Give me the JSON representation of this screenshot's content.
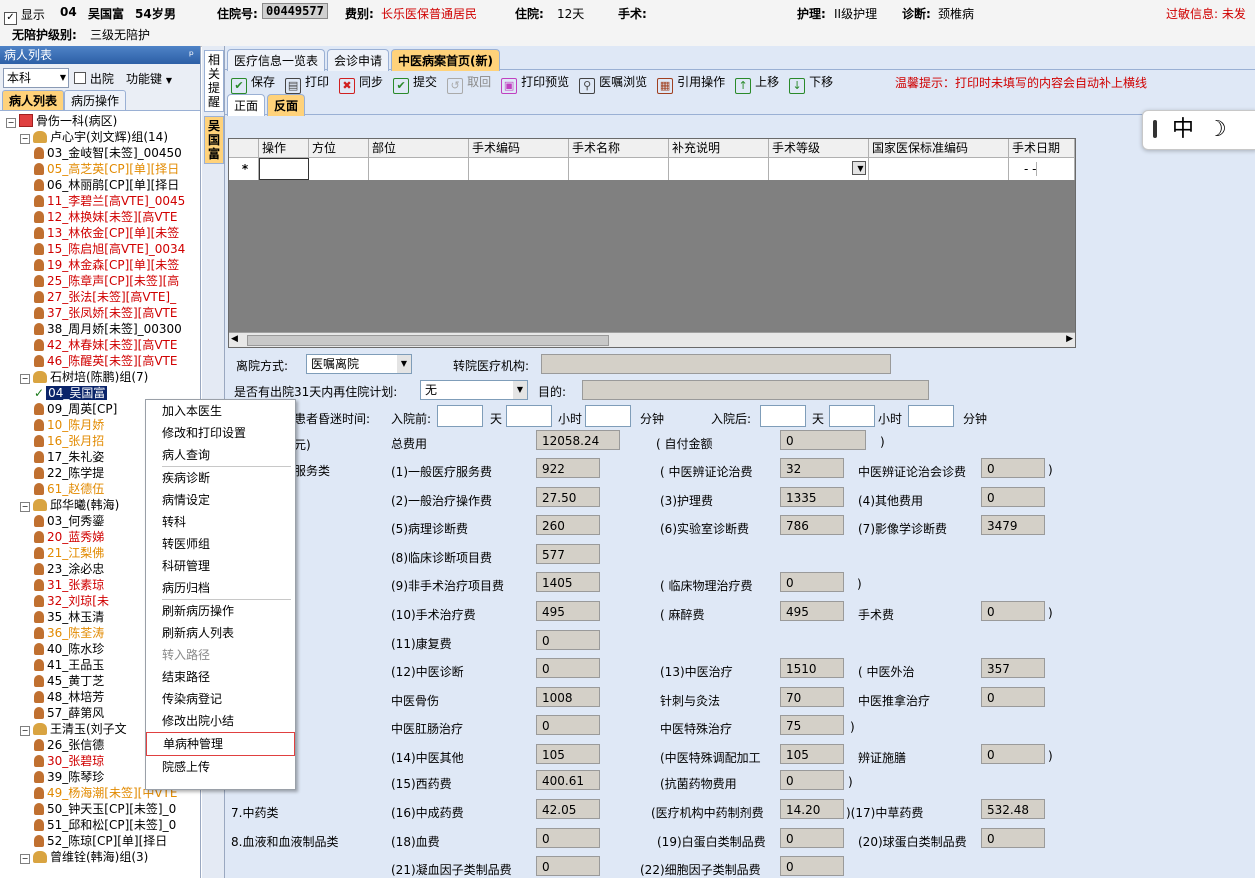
{
  "topbar": {
    "show_label": "显示",
    "bed_no": "04",
    "patient_name": "吴国富",
    "age": "54岁",
    "sex": "男",
    "admission_no_label": "住院号:",
    "admission_no": "00449577",
    "fee_type_label": "费别:",
    "fee_type": "长乐医保普通居民",
    "stay_label": "住院:",
    "stay_days": "12天",
    "surgery_label": "手术:",
    "care_label": "护理:",
    "care_value": "II级护理",
    "diagnosis_label": "诊断:",
    "diagnosis_value": "颈椎病",
    "allergy_text": "过敏信息: 未发",
    "escort_label": "无陪护级别:",
    "escort_value": "三级无陪护"
  },
  "left": {
    "header": "病人列表",
    "pin": "ᵖ",
    "dept_value": "本科",
    "discharge_label": "出院",
    "func_label": "功能键",
    "tabs": [
      "病人列表",
      "病历操作"
    ],
    "tree": [
      {
        "indent": 0,
        "type": "dept",
        "text": "骨伤一科(病区)",
        "color": "#000"
      },
      {
        "indent": 1,
        "type": "group",
        "text": "卢心宇(刘文辉)组(14)",
        "color": "#000"
      },
      {
        "indent": 2,
        "type": "p",
        "text": "03_金岐智[未签]_00450",
        "color": "#000"
      },
      {
        "indent": 2,
        "type": "p",
        "text": "05_高芝英[CP][单][择日",
        "color": "#e28a00"
      },
      {
        "indent": 2,
        "type": "p",
        "text": "06_林丽鹃[CP][单][择日",
        "color": "#000"
      },
      {
        "indent": 2,
        "type": "p",
        "text": "11_李碧兰[高VTE]_0045",
        "color": "#d00000"
      },
      {
        "indent": 2,
        "type": "p",
        "text": "12_林换妹[未签][高VTE",
        "color": "#d00000"
      },
      {
        "indent": 2,
        "type": "p",
        "text": "13_林依金[CP][单][未签",
        "color": "#d00000"
      },
      {
        "indent": 2,
        "type": "p",
        "text": "15_陈启旭[高VTE]_0034",
        "color": "#d00000"
      },
      {
        "indent": 2,
        "type": "p",
        "text": "19_林金森[CP][单][未签",
        "color": "#d00000"
      },
      {
        "indent": 2,
        "type": "p",
        "text": "25_陈章声[CP][未签][高",
        "color": "#d00000"
      },
      {
        "indent": 2,
        "type": "p",
        "text": "27_张法[未签][高VTE]_",
        "color": "#d00000"
      },
      {
        "indent": 2,
        "type": "p",
        "text": "37_张凤娇[未签][高VTE",
        "color": "#d00000"
      },
      {
        "indent": 2,
        "type": "p",
        "text": "38_周月娇[未签]_00300",
        "color": "#000"
      },
      {
        "indent": 2,
        "type": "p",
        "text": "42_林春妹[未签][高VTE",
        "color": "#d00000"
      },
      {
        "indent": 2,
        "type": "p",
        "text": "46_陈醒英[未签][高VTE",
        "color": "#d00000"
      },
      {
        "indent": 1,
        "type": "group",
        "text": "石树培(陈鹏)组(7)",
        "color": "#000"
      },
      {
        "indent": 2,
        "type": "sel",
        "text": "04_吴国富",
        "color": "#fff"
      },
      {
        "indent": 2,
        "type": "p",
        "text": "09_周英[CP]",
        "color": "#000"
      },
      {
        "indent": 2,
        "type": "p",
        "text": "10_陈月娇",
        "color": "#e28a00"
      },
      {
        "indent": 2,
        "type": "p",
        "text": "16_张月招",
        "color": "#e28a00"
      },
      {
        "indent": 2,
        "type": "p",
        "text": "17_朱礼姿",
        "color": "#000"
      },
      {
        "indent": 2,
        "type": "p",
        "text": "22_陈学提",
        "color": "#000"
      },
      {
        "indent": 2,
        "type": "p",
        "text": "61_赵德伍",
        "color": "#e28a00"
      },
      {
        "indent": 1,
        "type": "group",
        "text": "邱华曦(韩海)",
        "color": "#000"
      },
      {
        "indent": 2,
        "type": "p",
        "text": "03_何秀鎏",
        "color": "#000"
      },
      {
        "indent": 2,
        "type": "p",
        "text": "20_蓝秀娣",
        "color": "#d00000"
      },
      {
        "indent": 2,
        "type": "p",
        "text": "21_江梨佛",
        "color": "#e28a00"
      },
      {
        "indent": 2,
        "type": "p",
        "text": "23_涂必忠",
        "color": "#000"
      },
      {
        "indent": 2,
        "type": "p",
        "text": "31_张素琼",
        "color": "#d00000"
      },
      {
        "indent": 2,
        "type": "p",
        "text": "32_刘琼[未",
        "color": "#d00000"
      },
      {
        "indent": 2,
        "type": "p",
        "text": "35_林玉清",
        "color": "#000"
      },
      {
        "indent": 2,
        "type": "p",
        "text": "36_陈荃涛",
        "color": "#e28a00"
      },
      {
        "indent": 2,
        "type": "p",
        "text": "40_陈水珍",
        "color": "#000"
      },
      {
        "indent": 2,
        "type": "p",
        "text": "41_王品玉",
        "color": "#000"
      },
      {
        "indent": 2,
        "type": "p",
        "text": "45_黄丁芝",
        "color": "#000"
      },
      {
        "indent": 2,
        "type": "p",
        "text": "48_林培芳",
        "color": "#000"
      },
      {
        "indent": 2,
        "type": "p",
        "text": "57_薛第风",
        "color": "#000"
      },
      {
        "indent": 1,
        "type": "group",
        "text": "王清玉(刘子文",
        "color": "#000"
      },
      {
        "indent": 2,
        "type": "p",
        "text": "26_张信德",
        "color": "#000"
      },
      {
        "indent": 2,
        "type": "p",
        "text": "30_张碧琼",
        "color": "#d00000"
      },
      {
        "indent": 2,
        "type": "p",
        "text": "39_陈琴珍",
        "color": "#000"
      },
      {
        "indent": 2,
        "type": "p",
        "text": "49_杨海潮[未签][中VTE",
        "color": "#e28a00"
      },
      {
        "indent": 2,
        "type": "p",
        "text": "50_钟天玉[CP][未签]_0",
        "color": "#000"
      },
      {
        "indent": 2,
        "type": "p",
        "text": "51_邱和松[CP][未签]_0",
        "color": "#000"
      },
      {
        "indent": 2,
        "type": "p",
        "text": "52_陈琼[CP][单][择日",
        "color": "#000"
      },
      {
        "indent": 1,
        "type": "group",
        "text": "曾维铨(韩海)组(3)",
        "color": "#000"
      }
    ]
  },
  "vtabs": [
    "相关提醒",
    "吴国富"
  ],
  "main": {
    "tabs": [
      "医疗信息一览表",
      "会诊申请",
      "中医病案首页(新)"
    ],
    "toolbar": [
      {
        "label": "保存",
        "icon": "save-icon",
        "color": "#2a8a2a",
        "glyph": "✔",
        "disabled": false
      },
      {
        "label": "打印",
        "icon": "print-icon",
        "color": "#444",
        "glyph": "▤",
        "disabled": false
      },
      {
        "label": "同步",
        "icon": "sync-icon",
        "color": "#d02020",
        "glyph": "✖",
        "disabled": false
      },
      {
        "label": "提交",
        "icon": "submit-icon",
        "color": "#2a8a2a",
        "glyph": "✔",
        "disabled": false
      },
      {
        "label": "取回",
        "icon": "retrieve-icon",
        "color": "#aaa",
        "glyph": "↺",
        "disabled": true
      },
      {
        "label": "打印预览",
        "icon": "print-preview-icon",
        "color": "#c040c0",
        "glyph": "▣",
        "disabled": false
      },
      {
        "label": "医嘱浏览",
        "icon": "search-icon",
        "color": "#444",
        "glyph": "⚲",
        "disabled": false
      },
      {
        "label": "引用操作",
        "icon": "quote-icon",
        "color": "#a04020",
        "glyph": "▦",
        "disabled": false
      },
      {
        "label": "上移",
        "icon": "arrow-up-icon",
        "color": "#2a8a2a",
        "glyph": "↑",
        "disabled": false
      },
      {
        "label": "下移",
        "icon": "arrow-down-icon",
        "color": "#2a8a2a",
        "glyph": "↓",
        "disabled": false
      }
    ],
    "hint": "温馨提示：打印时未填写的内容会自动补上横线",
    "subtabs": [
      "正面",
      "反面"
    ],
    "grid_columns": [
      "操作",
      "方位",
      "部位",
      "手术编码",
      "手术名称",
      "补充说明",
      "手术等级",
      "国家医保标准编码",
      "手术日期"
    ],
    "grid_new_row_marker": "*",
    "grid_date_placeholder": "- -"
  },
  "form": {
    "discharge_method_label": "离院方式:",
    "discharge_method_value": "医嘱离院",
    "transfer_org_label": "转院医疗机构:",
    "readmit_label": "是否有出院31天内再住院计划:",
    "readmit_value": "无",
    "purpose_label": "目的:",
    "coma_label": "患者昏迷时间:",
    "before_label": "入院前:",
    "after_label": "入院后:",
    "day": "天",
    "hour": "小时",
    "minute": "分钟",
    "fee_unit_label": "元)",
    "service_label": "服务类",
    "total_label": "总费用",
    "total_value": "12058.24",
    "self_pay_label": "( 自付金额",
    "self_pay_value": "0",
    "close_paren": ")",
    "f1_label": "(1)一般医疗服务费",
    "f1": "922",
    "f_tcm_diff_label": "( 中医辨证论治费",
    "f_tcm_diff": "32",
    "f_tcm_consult_label": "中医辨证论治会诊费",
    "f_tcm_consult": "0",
    "f2_label": "(2)一般治疗操作费",
    "f2": "27.50",
    "f3_label": "(3)护理费",
    "f3": "1335",
    "f4_label": "(4)其他费用",
    "f4": "0",
    "f5_label": "(5)病理诊断费",
    "f5": "260",
    "f6_label": "(6)实验室诊断费",
    "f6": "786",
    "f7_label": "(7)影像学诊断费",
    "f7": "3479",
    "f8_label": "(8)临床诊断项目费",
    "f8": "577",
    "f9_label": "(9)非手术治疗项目费",
    "f9": "1405",
    "f_physio_label": "( 临床物理治疗费",
    "f_physio": "0",
    "f10_label": "(10)手术治疗费",
    "f10": "495",
    "f_anes_label": "( 麻醉费",
    "f_anes": "495",
    "f_surg_label": "手术费",
    "f_surg": "0",
    "f11_label": "(11)康复费",
    "f11": "0",
    "f12_label": "(12)中医诊断",
    "f12": "0",
    "f13_label": "(13)中医治疗",
    "f13": "1510",
    "f_ext_label": "( 中医外治",
    "f_ext": "357",
    "f_bone_label": "中医骨伤",
    "f_bone": "1008",
    "f_acu_label": "针刺与灸法",
    "f_acu": "70",
    "f_tuina_label": "中医推拿治疗",
    "f_tuina": "0",
    "f_anal_label": "中医肛肠治疗",
    "f_anal": "0",
    "f_special_label": "中医特殊治疗",
    "f_special": "75",
    "f14_label": "(14)中医其他",
    "f14": "105",
    "f_prep_label": "(中医特殊调配加工",
    "f_prep": "105",
    "f_diet_label": "辨证施膳",
    "f_diet": "0",
    "f15_label": "(15)西药费",
    "f15": "400.61",
    "f_anti_label": "(抗菌药物费用",
    "f_anti": "0",
    "cat7_label": "7.中药类",
    "f16_label": "(16)中成药费",
    "f16": "42.05",
    "f_inst_label": "(医疗机构中药制剂费",
    "f_inst": "14.20",
    "f17_label": ")(17)中草药费",
    "f17": "532.48",
    "cat8_label": "8.血液和血液制品类",
    "f18_label": "(18)血费",
    "f18": "0",
    "f19_label": "(19)白蛋白类制品费",
    "f19": "0",
    "f20_label": "(20)球蛋白类制品费",
    "f20": "0",
    "f21_label": "(21)凝血因子类制品费",
    "f21": "0",
    "f22_label": "(22)细胞因子类制品费",
    "f22": "0"
  },
  "context_menu": {
    "groups": [
      [
        {
          "label": "加入本医生",
          "disabled": false
        },
        {
          "label": "修改和打印设置",
          "disabled": false
        },
        {
          "label": "病人查询",
          "disabled": false
        }
      ],
      [
        {
          "label": "疾病诊断",
          "disabled": false
        },
        {
          "label": "病情设定",
          "disabled": false
        },
        {
          "label": "转科",
          "disabled": false
        },
        {
          "label": "转医师组",
          "disabled": false
        },
        {
          "label": "科研管理",
          "disabled": false
        },
        {
          "label": "病历归档",
          "disabled": false
        }
      ],
      [
        {
          "label": "刷新病历操作",
          "disabled": false
        },
        {
          "label": "刷新病人列表",
          "disabled": false
        },
        {
          "label": "转入路径",
          "disabled": true
        },
        {
          "label": "结束路径",
          "disabled": false
        },
        {
          "label": "传染病登记",
          "disabled": false
        },
        {
          "label": "修改出院小结",
          "disabled": false
        },
        {
          "label": "单病种管理",
          "disabled": false,
          "highlight": true
        },
        {
          "label": "院感上传",
          "disabled": false
        }
      ]
    ]
  },
  "ime": {
    "mode": "中",
    "moon": "☽"
  }
}
